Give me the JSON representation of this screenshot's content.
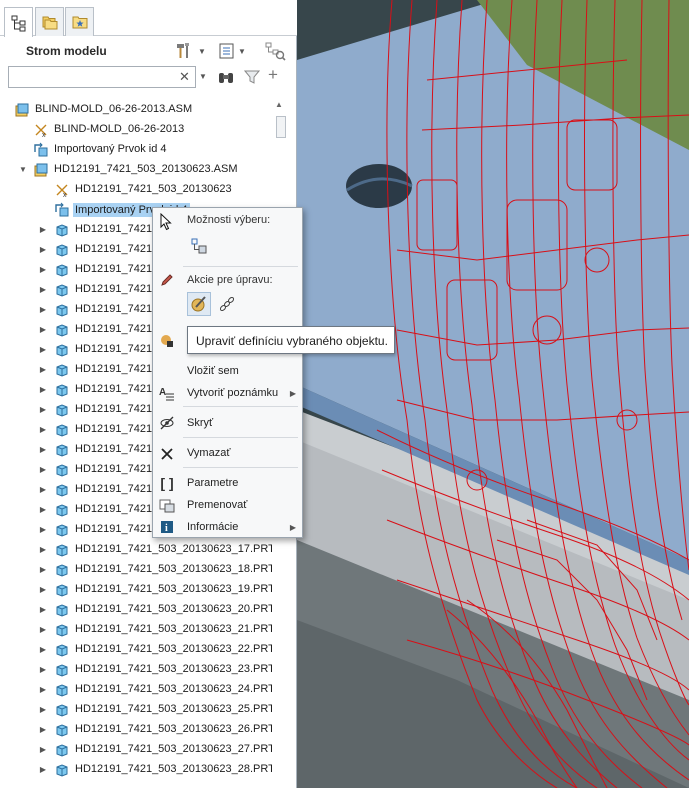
{
  "panel": {
    "title": "Strom modelu",
    "search": {
      "value": "",
      "placeholder": ""
    }
  },
  "tree": {
    "items": [
      {
        "label": "BLIND-MOLD_06-26-2013.ASM",
        "icon": "assembly-icon",
        "depth": 0,
        "arrow": ""
      },
      {
        "label": "BLIND-MOLD_06-26-2013",
        "icon": "csys-icon",
        "depth": 1,
        "arrow": ""
      },
      {
        "label": "Importovaný Prvok id 4",
        "icon": "import-feature-icon",
        "depth": 1,
        "arrow": ""
      },
      {
        "label": "HD12191_7421_503_20130623.ASM",
        "icon": "assembly-icon",
        "depth": 1,
        "arrow": "down"
      },
      {
        "label": "HD12191_7421_503_20130623",
        "icon": "csys-icon",
        "depth": 2,
        "arrow": ""
      },
      {
        "label": "Importovaný Prvok id 4",
        "icon": "import-feature-icon",
        "depth": 2,
        "arrow": "",
        "selected": true
      },
      {
        "label": "HD12191_7421_",
        "icon": "part-icon",
        "depth": 2,
        "arrow": "right"
      },
      {
        "label": "HD12191_7421_",
        "icon": "part-icon",
        "depth": 2,
        "arrow": "right"
      },
      {
        "label": "HD12191_7421_",
        "icon": "part-icon",
        "depth": 2,
        "arrow": "right"
      },
      {
        "label": "HD12191_7421_",
        "icon": "part-icon",
        "depth": 2,
        "arrow": "right"
      },
      {
        "label": "HD12191_7421_",
        "icon": "part-icon",
        "depth": 2,
        "arrow": "right"
      },
      {
        "label": "HD12191_7421_",
        "icon": "part-icon",
        "depth": 2,
        "arrow": "right"
      },
      {
        "label": "HD12191_7421_",
        "icon": "part-icon",
        "depth": 2,
        "arrow": "right"
      },
      {
        "label": "HD12191_7421_",
        "icon": "part-icon",
        "depth": 2,
        "arrow": "right"
      },
      {
        "label": "HD12191_7421_",
        "icon": "part-icon",
        "depth": 2,
        "arrow": "right"
      },
      {
        "label": "HD12191_7421_",
        "icon": "part-icon",
        "depth": 2,
        "arrow": "right"
      },
      {
        "label": "HD12191_7421_",
        "icon": "part-icon",
        "depth": 2,
        "arrow": "right"
      },
      {
        "label": "HD12191_7421_",
        "icon": "part-icon",
        "depth": 2,
        "arrow": "right"
      },
      {
        "label": "HD12191_7421_",
        "icon": "part-icon",
        "depth": 2,
        "arrow": "right"
      },
      {
        "label": "HD12191_7421_",
        "icon": "part-icon",
        "depth": 2,
        "arrow": "right"
      },
      {
        "label": "HD12191_7421_",
        "icon": "part-icon",
        "depth": 2,
        "arrow": "right"
      },
      {
        "label": "HD12191_7421_",
        "icon": "part-icon",
        "depth": 2,
        "arrow": "right"
      },
      {
        "label": "HD12191_7421_503_20130623_17.PRT",
        "icon": "part-icon",
        "depth": 2,
        "arrow": "right"
      },
      {
        "label": "HD12191_7421_503_20130623_18.PRT",
        "icon": "part-icon",
        "depth": 2,
        "arrow": "right"
      },
      {
        "label": "HD12191_7421_503_20130623_19.PRT",
        "icon": "part-icon",
        "depth": 2,
        "arrow": "right"
      },
      {
        "label": "HD12191_7421_503_20130623_20.PRT",
        "icon": "part-icon",
        "depth": 2,
        "arrow": "right"
      },
      {
        "label": "HD12191_7421_503_20130623_21.PRT",
        "icon": "part-icon",
        "depth": 2,
        "arrow": "right"
      },
      {
        "label": "HD12191_7421_503_20130623_22.PRT",
        "icon": "part-icon",
        "depth": 2,
        "arrow": "right"
      },
      {
        "label": "HD12191_7421_503_20130623_23.PRT",
        "icon": "part-icon",
        "depth": 2,
        "arrow": "right"
      },
      {
        "label": "HD12191_7421_503_20130623_24.PRT",
        "icon": "part-icon",
        "depth": 2,
        "arrow": "right"
      },
      {
        "label": "HD12191_7421_503_20130623_25.PRT",
        "icon": "part-icon",
        "depth": 2,
        "arrow": "right"
      },
      {
        "label": "HD12191_7421_503_20130623_26.PRT",
        "icon": "part-icon",
        "depth": 2,
        "arrow": "right"
      },
      {
        "label": "HD12191_7421_503_20130623_27.PRT",
        "icon": "part-icon",
        "depth": 2,
        "arrow": "right"
      },
      {
        "label": "HD12191_7421_503_20130623_28.PRT",
        "icon": "part-icon",
        "depth": 2,
        "arrow": "right"
      }
    ]
  },
  "context_menu": {
    "section_selection": "Možnosti výberu:",
    "section_edit": "Akcie pre úpravu:",
    "items": {
      "insert_here": "Vložiť sem",
      "create_note": "Vytvoriť poznámku",
      "hide": "Skryť",
      "delete": "Vymazať",
      "parameters": "Parametre",
      "rename": "Premenovať",
      "info": "Informácie"
    }
  },
  "tooltip": {
    "text": "Upraviť definíciu vybraného objektu."
  },
  "colors": {
    "selection": "#a9d2f3",
    "wireframe": "#d80f17",
    "plate": "#8ba8c9",
    "mold_green": "#6d8a4d"
  }
}
